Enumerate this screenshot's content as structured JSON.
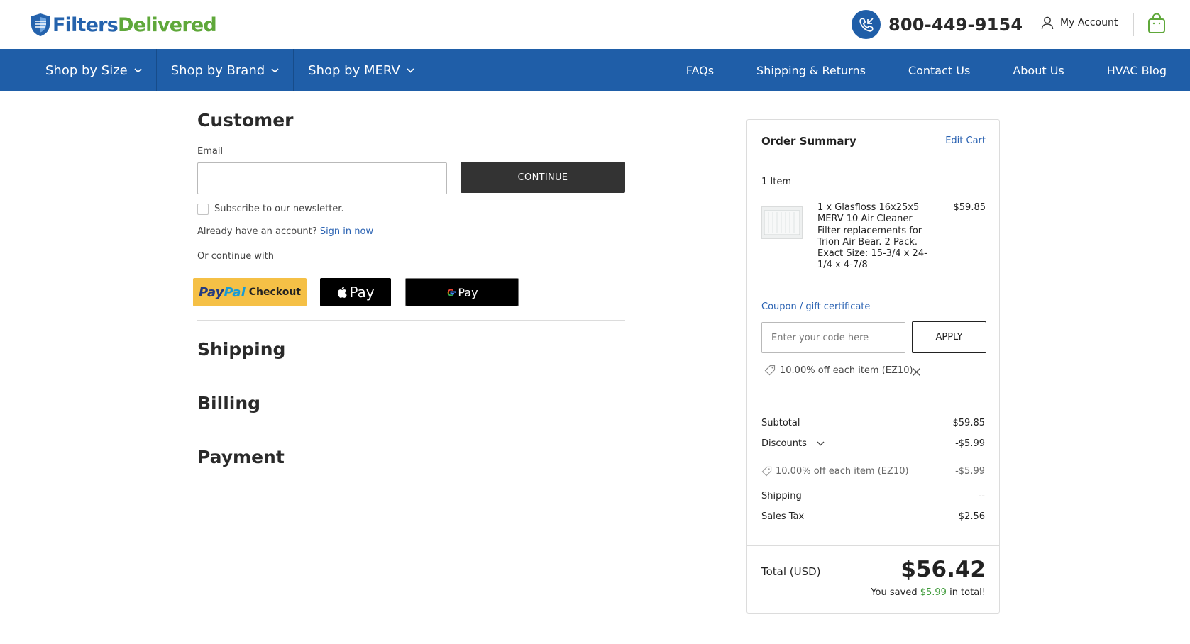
{
  "header": {
    "logo_part1": "Filters",
    "logo_part2": "Delivered",
    "phone": "800-449-9154",
    "account_label": "My Account",
    "icons": [
      "shield-logo-icon",
      "phone-icon",
      "user-icon",
      "shopping-bag-icon"
    ]
  },
  "nav": {
    "dropdowns": [
      "Shop by Size",
      "Shop by Brand",
      "Shop by MERV"
    ],
    "links": [
      "FAQs",
      "Shipping & Returns",
      "Contact Us",
      "About Us",
      "HVAC Blog"
    ]
  },
  "checkout": {
    "customer_title": "Customer",
    "email_label": "Email",
    "email_value": "",
    "continue_label": "CONTINUE",
    "newsletter_label": "Subscribe to our newsletter.",
    "account_prompt": "Already have an account?",
    "sign_in_label": "Sign in now",
    "or_continue": "Or continue with",
    "paypal_pay": "Pay",
    "paypal_pal": "Pal",
    "paypal_checkout": "Checkout",
    "applepay_label": "Pay",
    "gpay_label": "Pay",
    "shipping_title": "Shipping",
    "billing_title": "Billing",
    "payment_title": "Payment"
  },
  "summary": {
    "title": "Order Summary",
    "edit_cart": "Edit Cart",
    "item_count": "1 Item",
    "item_description": "1 x Glasfloss 16x25x5 MERV 10 Air Cleaner Filter replacements for Trion Air Bear. 2 Pack. Exact Size: 15-3/4 x 24-1/4 x 4-7/8",
    "item_price": "$59.85",
    "coupon_link": "Coupon / gift certificate",
    "coupon_placeholder": "Enter your code here",
    "apply_label": "APPLY",
    "applied_coupon": "10.00% off each item (EZ10)",
    "subtotal_label": "Subtotal",
    "subtotal_value": "$59.85",
    "discounts_label": "Discounts",
    "discounts_value": "-$5.99",
    "discount_line_label": "10.00% off each item (EZ10)",
    "discount_line_value": "-$5.99",
    "shipping_label": "Shipping",
    "shipping_value": "--",
    "tax_label": "Sales Tax",
    "tax_value": "$2.56",
    "total_label": "Total (USD)",
    "total_value": "$56.42",
    "saved_prefix": "You saved",
    "saved_amount": "$5.99",
    "saved_suffix": "in total!"
  },
  "colors": {
    "brand_blue": "#1f5ea8",
    "brand_green": "#5fa83a",
    "link_blue": "#2a62b2",
    "savings_green": "#3f9b3a",
    "paypal_yellow": "#f5c046"
  }
}
